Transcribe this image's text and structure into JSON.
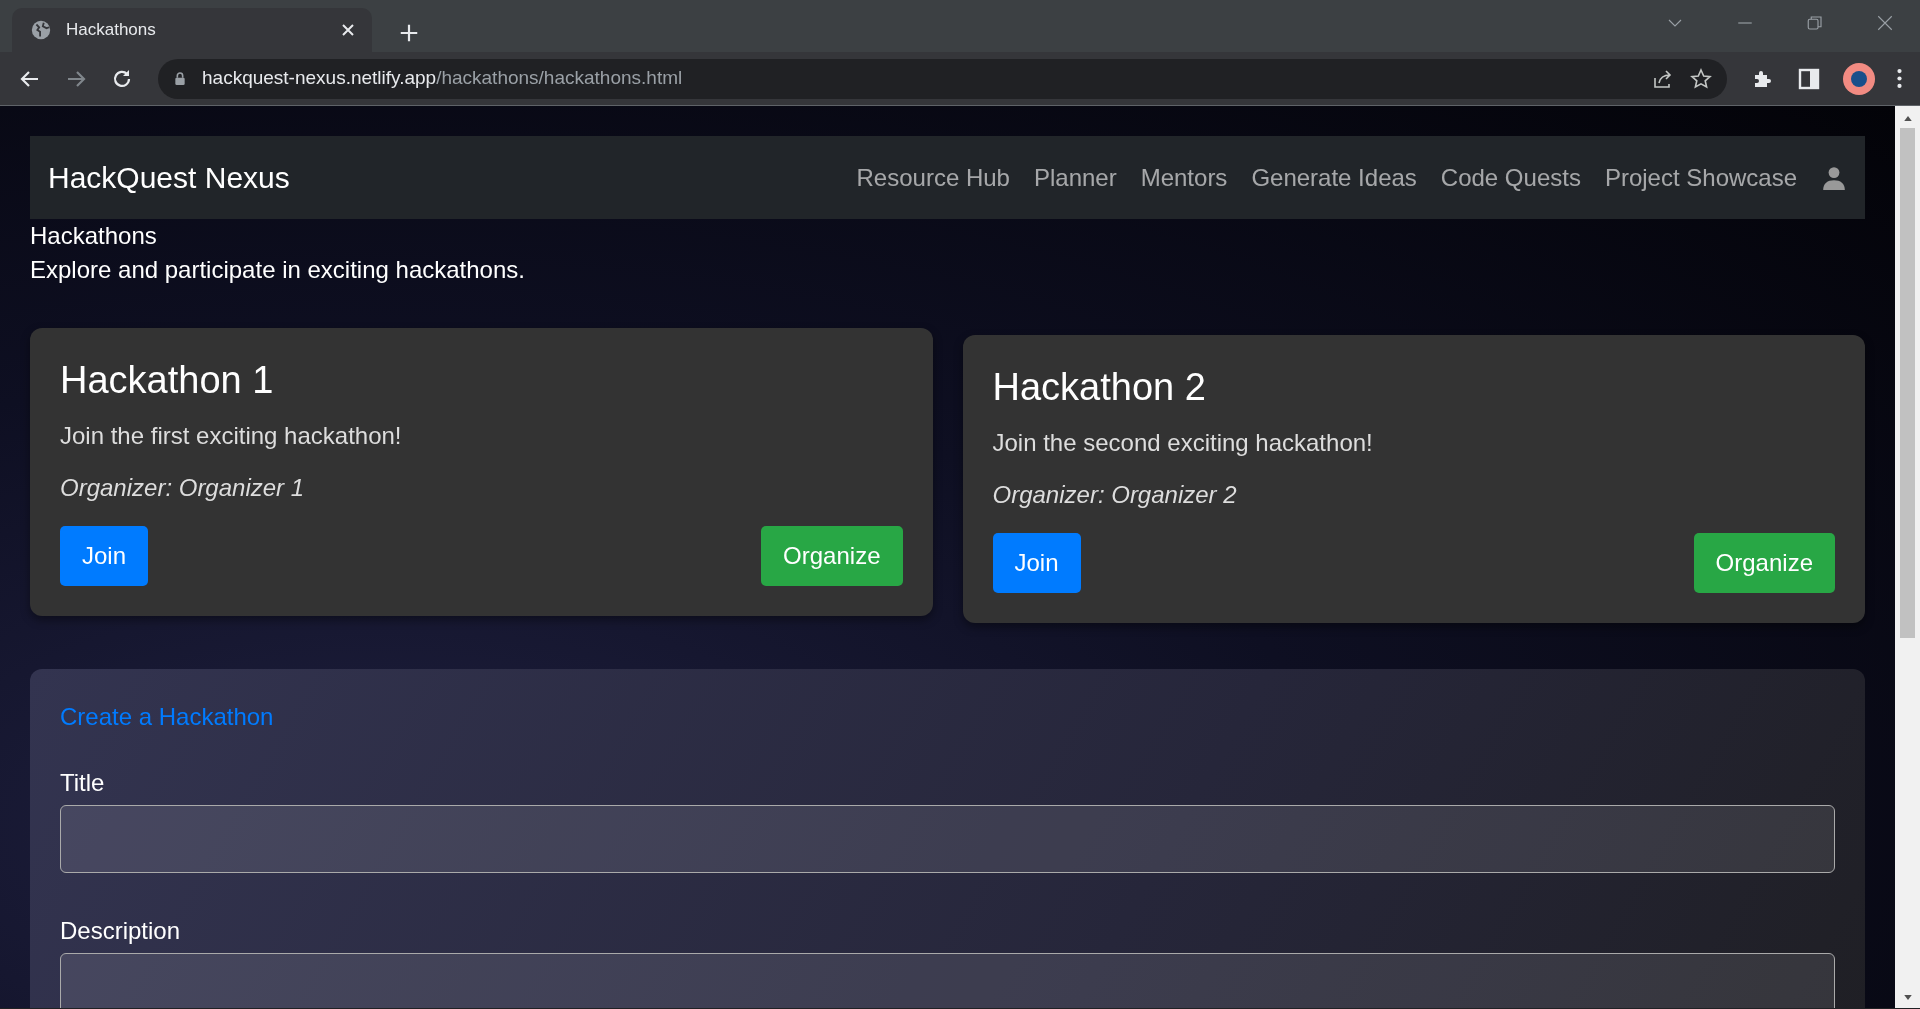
{
  "browser": {
    "tab_title": "Hackathons",
    "url_host": "hackquest-nexus.netlify.app",
    "url_path": "/hackathons/hackathons.html"
  },
  "navbar": {
    "brand": "HackQuest Nexus",
    "items": [
      "Resource Hub",
      "Planner",
      "Mentors",
      "Generate Ideas",
      "Code Quests",
      "Project Showcase"
    ]
  },
  "header": {
    "title": "Hackathons",
    "subtitle": "Explore and participate in exciting hackathons."
  },
  "hackathons": [
    {
      "title": "Hackathon 1",
      "description": "Join the first exciting hackathon!",
      "organizer": "Organizer: Organizer 1",
      "buttons": [
        "Join",
        "Organize"
      ]
    },
    {
      "title": "Hackathon 2",
      "description": "Join the second exciting hackathon!",
      "organizer": "Organizer: Organizer 2",
      "buttons": [
        "Join",
        "Organize"
      ]
    }
  ],
  "form": {
    "title": "Create a Hackathon",
    "fields": [
      {
        "label": "Title",
        "kind": "input"
      },
      {
        "label": "Description",
        "kind": "textarea"
      }
    ]
  }
}
